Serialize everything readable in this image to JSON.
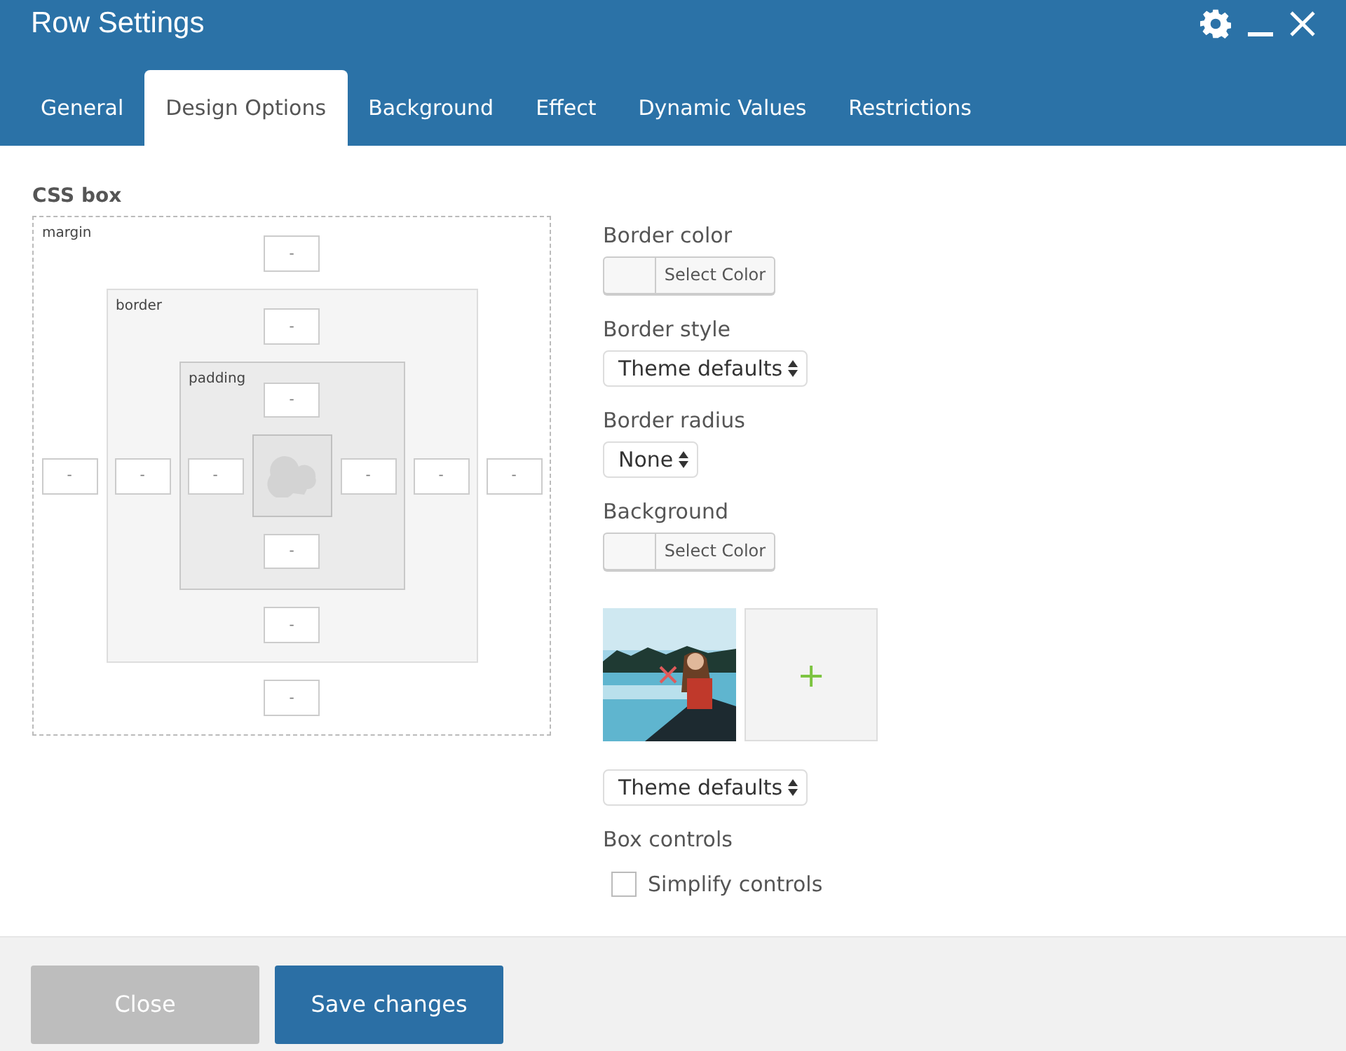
{
  "window": {
    "title": "Row Settings"
  },
  "tabs": [
    {
      "label": "General",
      "selected": false
    },
    {
      "label": "Design Options",
      "selected": true
    },
    {
      "label": "Background",
      "selected": false
    },
    {
      "label": "Effect",
      "selected": false
    },
    {
      "label": "Dynamic Values",
      "selected": false
    },
    {
      "label": "Restrictions",
      "selected": false
    }
  ],
  "css_box": {
    "title": "CSS box",
    "margin": {
      "label": "margin",
      "top": "-",
      "left": "-",
      "right": "-",
      "bottom": "-"
    },
    "border": {
      "label": "border",
      "top": "-",
      "left": "-",
      "right": "-",
      "bottom": "-"
    },
    "padding": {
      "label": "padding",
      "top": "-",
      "left": "-",
      "right": "-",
      "bottom": "-"
    }
  },
  "options": [
    {
      "kind": "color",
      "label": "Border color",
      "button": "Select Color"
    },
    {
      "kind": "select",
      "label": "Border style",
      "value": "Theme defaults"
    },
    {
      "kind": "select",
      "label": "Border radius",
      "value": "None"
    },
    {
      "kind": "color",
      "label": "Background",
      "button": "Select Color"
    },
    {
      "kind": "images",
      "add": "+"
    },
    {
      "kind": "select",
      "value": "Theme defaults"
    },
    {
      "kind": "checkbox",
      "label": "Box controls",
      "option": "Simplify controls",
      "checked": false
    }
  ],
  "buttons": [
    {
      "label": "Close",
      "disabled": true
    },
    {
      "label": "Save changes",
      "disabled": false
    }
  ]
}
